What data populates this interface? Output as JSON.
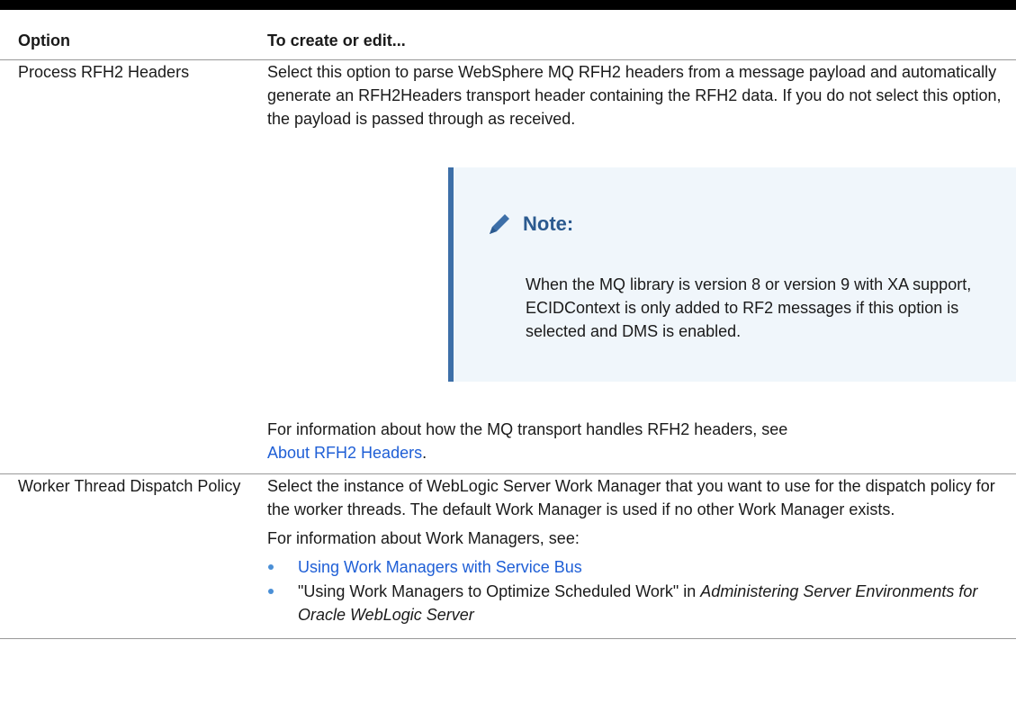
{
  "table": {
    "headers": [
      "Option",
      "To create or edit..."
    ],
    "rows": [
      {
        "option": "Process RFH2 Headers",
        "description": "Select this option to parse WebSphere MQ RFH2 headers from a message payload and automatically generate an RFH2Headers transport header containing the RFH2 data. If you do not select this option, the payload is passed through as received.",
        "note": {
          "title": "Note:",
          "body": "When the MQ library is version 8 or version 9 with XA support, ECIDContext is only added to RF2 messages if this option is selected and DMS is enabled."
        },
        "after_note_text": "For information about how the MQ transport handles RFH2 headers, see",
        "after_note_link": "About RFH2 Headers",
        "after_note_end": "."
      },
      {
        "option": "Worker Thread Dispatch Policy",
        "description": "Select the instance of WebLogic Server Work Manager that you want to use for the dispatch policy for the worker threads. The default Work Manager is used if no other Work Manager exists.",
        "info_text": "For information about Work Managers, see:",
        "bullets": [
          {
            "link": "Using Work Managers with Service Bus"
          },
          {
            "text": "\"Using Work Managers to Optimize Scheduled Work\" in ",
            "italic": "Administering Server Environments for Oracle WebLogic Server"
          }
        ]
      }
    ]
  },
  "colors": {
    "link": "#1f5fd6",
    "note_accent": "#3d6fa8",
    "note_bg": "#f0f6fb",
    "bullet": "#4a8fd6"
  },
  "icons": {
    "note": "pencil-icon"
  }
}
